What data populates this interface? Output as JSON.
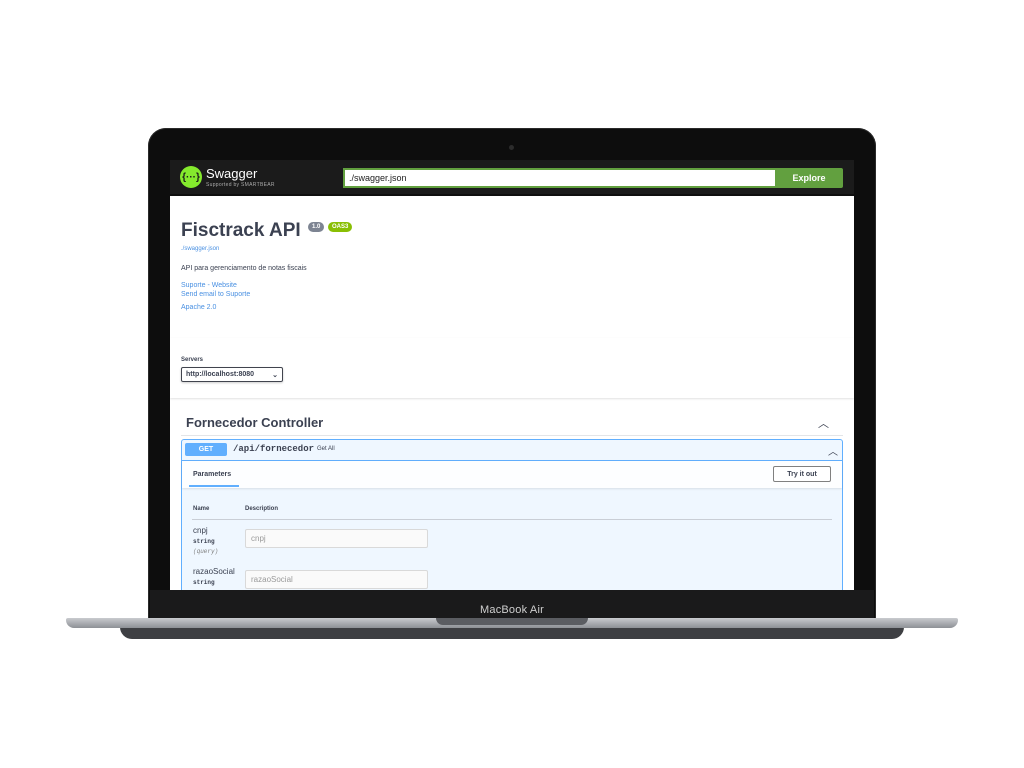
{
  "device": {
    "label": "MacBook Air"
  },
  "topbar": {
    "logo_symbol": "{···}",
    "logo_text": "Swagger",
    "logo_subtext": "Supported by SMARTBEAR",
    "url_value": "./swagger.json",
    "explore_label": "Explore",
    "accent_color": "#62a03f"
  },
  "info": {
    "title": "Fisctrack API",
    "version": "1.0",
    "oas": "OAS3",
    "spec_url": "./swagger.json",
    "description": "API para gerenciamento de notas fiscais",
    "links": [
      "Suporte - Website",
      "Send email to Suporte",
      "Apache 2.0"
    ]
  },
  "servers": {
    "label": "Servers",
    "selected": "http://localhost:8080"
  },
  "tag": {
    "title": "Fornecedor Controller",
    "operation": {
      "method": "GET",
      "path": "/api/fornecedor",
      "summary": "Get All",
      "parameters_tab": "Parameters",
      "try_label": "Try it out",
      "columns": {
        "name": "Name",
        "description": "Description"
      },
      "params": [
        {
          "name": "cnpj",
          "type": "string",
          "in": "(query)",
          "placeholder": "cnpj"
        },
        {
          "name": "razaoSocial",
          "type": "string",
          "in": "",
          "placeholder": "razaoSocial"
        }
      ],
      "get_color": "#61affe"
    }
  }
}
